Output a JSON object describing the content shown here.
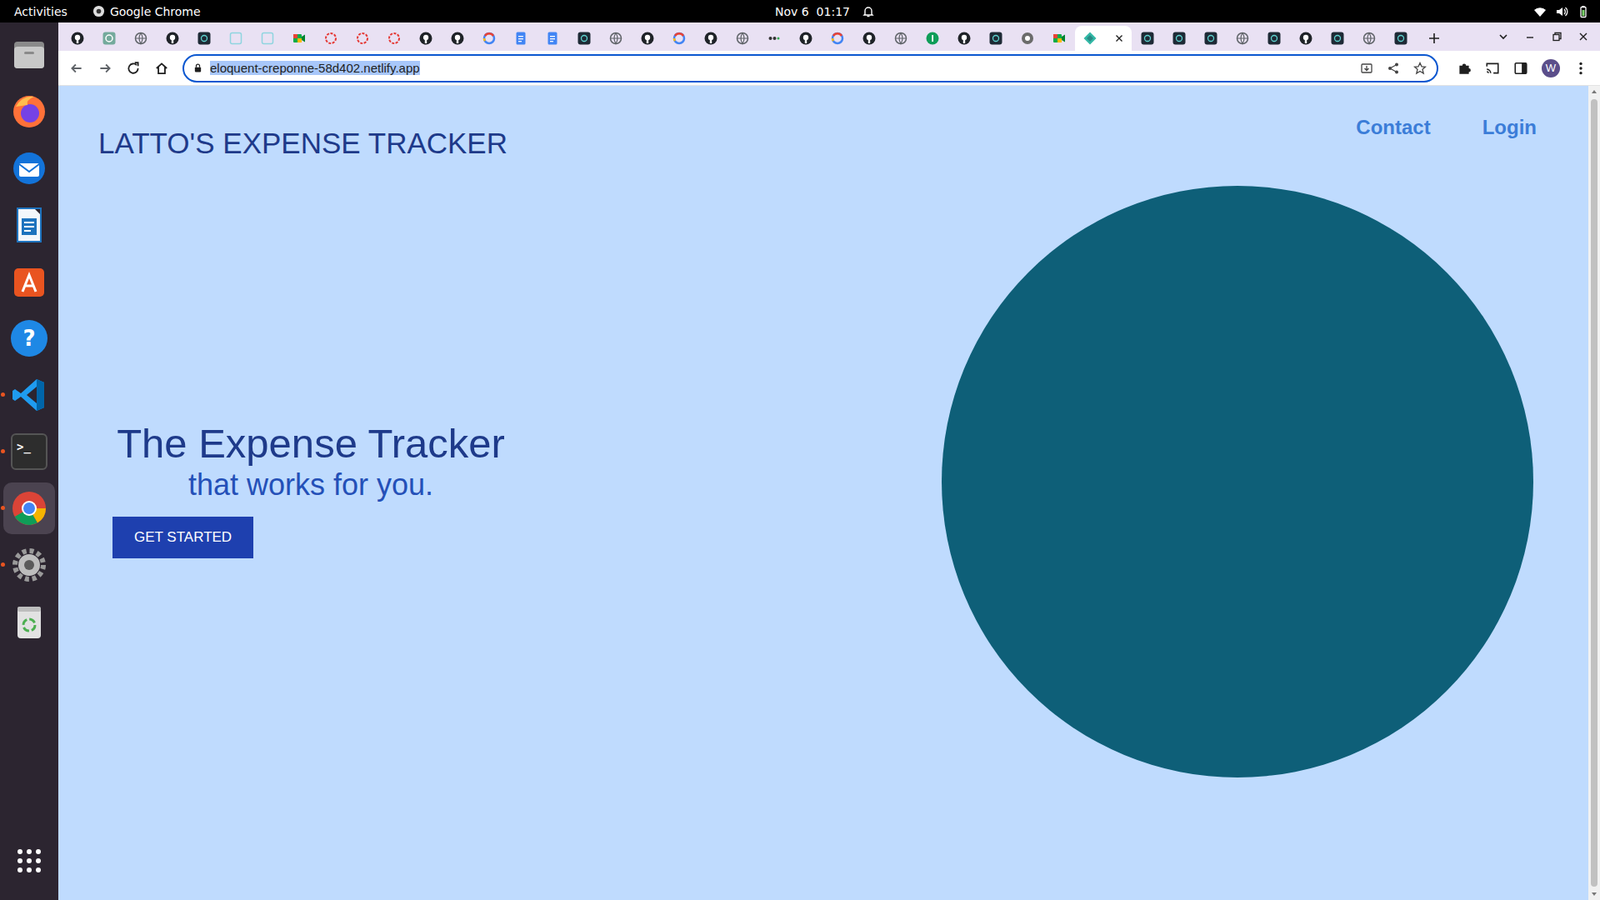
{
  "top_bar": {
    "activities": "Activities",
    "app": "Google Chrome",
    "clock": "Nov 6  01:17"
  },
  "dock": {
    "items": [
      {
        "kind": "files",
        "running": false,
        "selected": false
      },
      {
        "kind": "firefox",
        "running": false,
        "selected": false
      },
      {
        "kind": "thunderbird",
        "running": false,
        "selected": false
      },
      {
        "kind": "writer",
        "running": false,
        "selected": false
      },
      {
        "kind": "appcenter",
        "running": false,
        "selected": false
      },
      {
        "kind": "help",
        "glyph": "?",
        "running": false,
        "selected": false
      },
      {
        "kind": "vscode",
        "running": true,
        "selected": false
      },
      {
        "kind": "terminal",
        "glyph": ">_",
        "running": true,
        "selected": false
      },
      {
        "kind": "chrome",
        "running": true,
        "selected": true
      },
      {
        "kind": "settings",
        "running": true,
        "selected": false
      },
      {
        "kind": "trash",
        "running": false,
        "selected": false
      }
    ]
  },
  "browser": {
    "tabs": [
      {
        "kind": "github",
        "selected": false
      },
      {
        "kind": "chatgpt",
        "selected": false
      },
      {
        "kind": "globe",
        "selected": false
      },
      {
        "kind": "github",
        "selected": false
      },
      {
        "kind": "app",
        "selected": false
      },
      {
        "kind": "teal",
        "selected": false
      },
      {
        "kind": "teal",
        "selected": false
      },
      {
        "kind": "meet",
        "selected": false
      },
      {
        "kind": "red",
        "selected": false
      },
      {
        "kind": "red",
        "selected": false
      },
      {
        "kind": "red",
        "selected": false
      },
      {
        "kind": "github",
        "selected": false
      },
      {
        "kind": "github",
        "selected": false
      },
      {
        "kind": "google",
        "selected": false
      },
      {
        "kind": "doc",
        "selected": false
      },
      {
        "kind": "doc",
        "selected": false
      },
      {
        "kind": "app",
        "selected": false
      },
      {
        "kind": "globe",
        "selected": false
      },
      {
        "kind": "github",
        "selected": false
      },
      {
        "kind": "google",
        "selected": false
      },
      {
        "kind": "github",
        "selected": false
      },
      {
        "kind": "globe",
        "selected": false
      },
      {
        "kind": "dots",
        "selected": false
      },
      {
        "kind": "github",
        "selected": false
      },
      {
        "kind": "google",
        "selected": false
      },
      {
        "kind": "github",
        "selected": false
      },
      {
        "kind": "globe",
        "selected": false
      },
      {
        "kind": "green",
        "selected": false
      },
      {
        "kind": "github",
        "selected": false
      },
      {
        "kind": "app",
        "selected": false
      },
      {
        "kind": "chrome",
        "selected": false
      },
      {
        "kind": "meet",
        "selected": false
      },
      {
        "kind": "netlify",
        "selected": true
      },
      {
        "kind": "app",
        "selected": false
      },
      {
        "kind": "app",
        "selected": false
      },
      {
        "kind": "app",
        "selected": false
      },
      {
        "kind": "globe",
        "selected": false
      },
      {
        "kind": "app",
        "selected": false
      },
      {
        "kind": "github",
        "selected": false
      },
      {
        "kind": "app",
        "selected": false
      },
      {
        "kind": "globe",
        "selected": false
      },
      {
        "kind": "app",
        "selected": false
      }
    ],
    "address_bar": {
      "url": "eloquent-creponne-58d402.netlify.app",
      "selected": true
    },
    "profile": {
      "initial": "W"
    }
  },
  "page": {
    "brand": "LATTO'S EXPENSE TRACKER",
    "nav": [
      {
        "label": "Contact"
      },
      {
        "label": "Login"
      }
    ],
    "hero": {
      "title": "The Expense Tracker",
      "subtitle": "that works for you.",
      "button": "GET STARTED"
    }
  }
}
